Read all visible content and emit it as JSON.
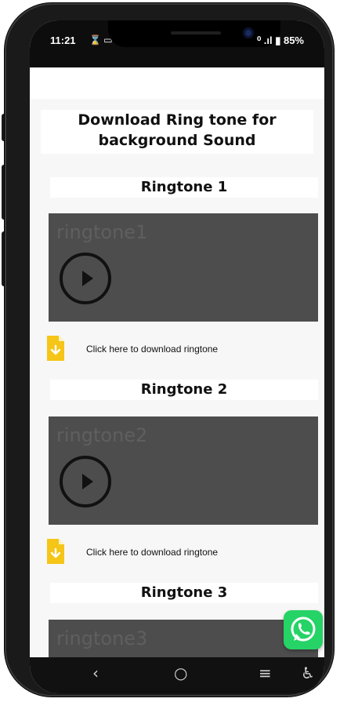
{
  "status": {
    "time": "11:21",
    "left_icons": "⌛ ▭",
    "right": "⁰ .ıl ▮ 85%"
  },
  "page": {
    "title": "Download Ring tone for background Sound"
  },
  "ringtones": [
    {
      "heading": "Ringtone 1",
      "player_label": "ringtone1",
      "download_text": "Click here to download ringtone"
    },
    {
      "heading": "Ringtone 2",
      "player_label": "ringtone2",
      "download_text": "Click here to download ringtone"
    },
    {
      "heading": "Ringtone 3",
      "player_label": "ringtone3"
    }
  ],
  "nav": {
    "back": "‹",
    "home": "○",
    "menu": "≡",
    "accessibility": "♿"
  },
  "colors": {
    "player_bg": "#4d4d4d",
    "download_icon": "#f5c518",
    "whatsapp": "#25d366"
  },
  "icons": {
    "download": "file-download-icon",
    "whatsapp": "whatsapp-icon",
    "play": "play-icon"
  }
}
